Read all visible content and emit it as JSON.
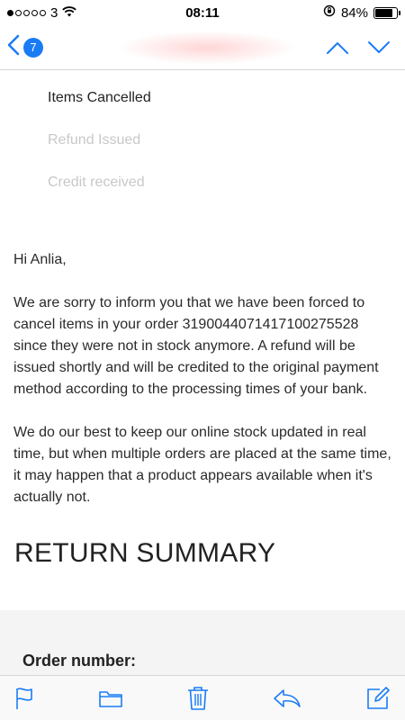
{
  "status_bar": {
    "carrier": "3",
    "signal_bars": 1,
    "signal_total": 5,
    "time": "08:11",
    "battery_percent": "84%",
    "battery_level": 0.84
  },
  "nav": {
    "badge_count": "7",
    "accent_color": "#1a7cf5"
  },
  "steps": [
    {
      "label": "Items Cancelled",
      "state": "active"
    },
    {
      "label": "Refund Issued",
      "state": "inactive"
    },
    {
      "label": "Credit received",
      "state": "inactive"
    }
  ],
  "email": {
    "greeting": "Hi Anlia,",
    "paragraph1": "We are sorry to inform you that we have been forced to cancel items in your order 3190044071417100275528 since they were not in stock anymore. A refund will be issued shortly and will be credited to the original payment method according to the processing times of your bank.",
    "paragraph2": "We do our best to keep our online stock updated in real time, but when multiple orders are placed at the same time, it may happen that a product appears available when it's actually not.",
    "return_summary": "RETURN SUMMARY",
    "order_number_label": "Order number:"
  },
  "toolbar": {
    "icons": [
      "flag-icon",
      "folder-icon",
      "trash-icon",
      "reply-icon",
      "compose-icon"
    ]
  }
}
